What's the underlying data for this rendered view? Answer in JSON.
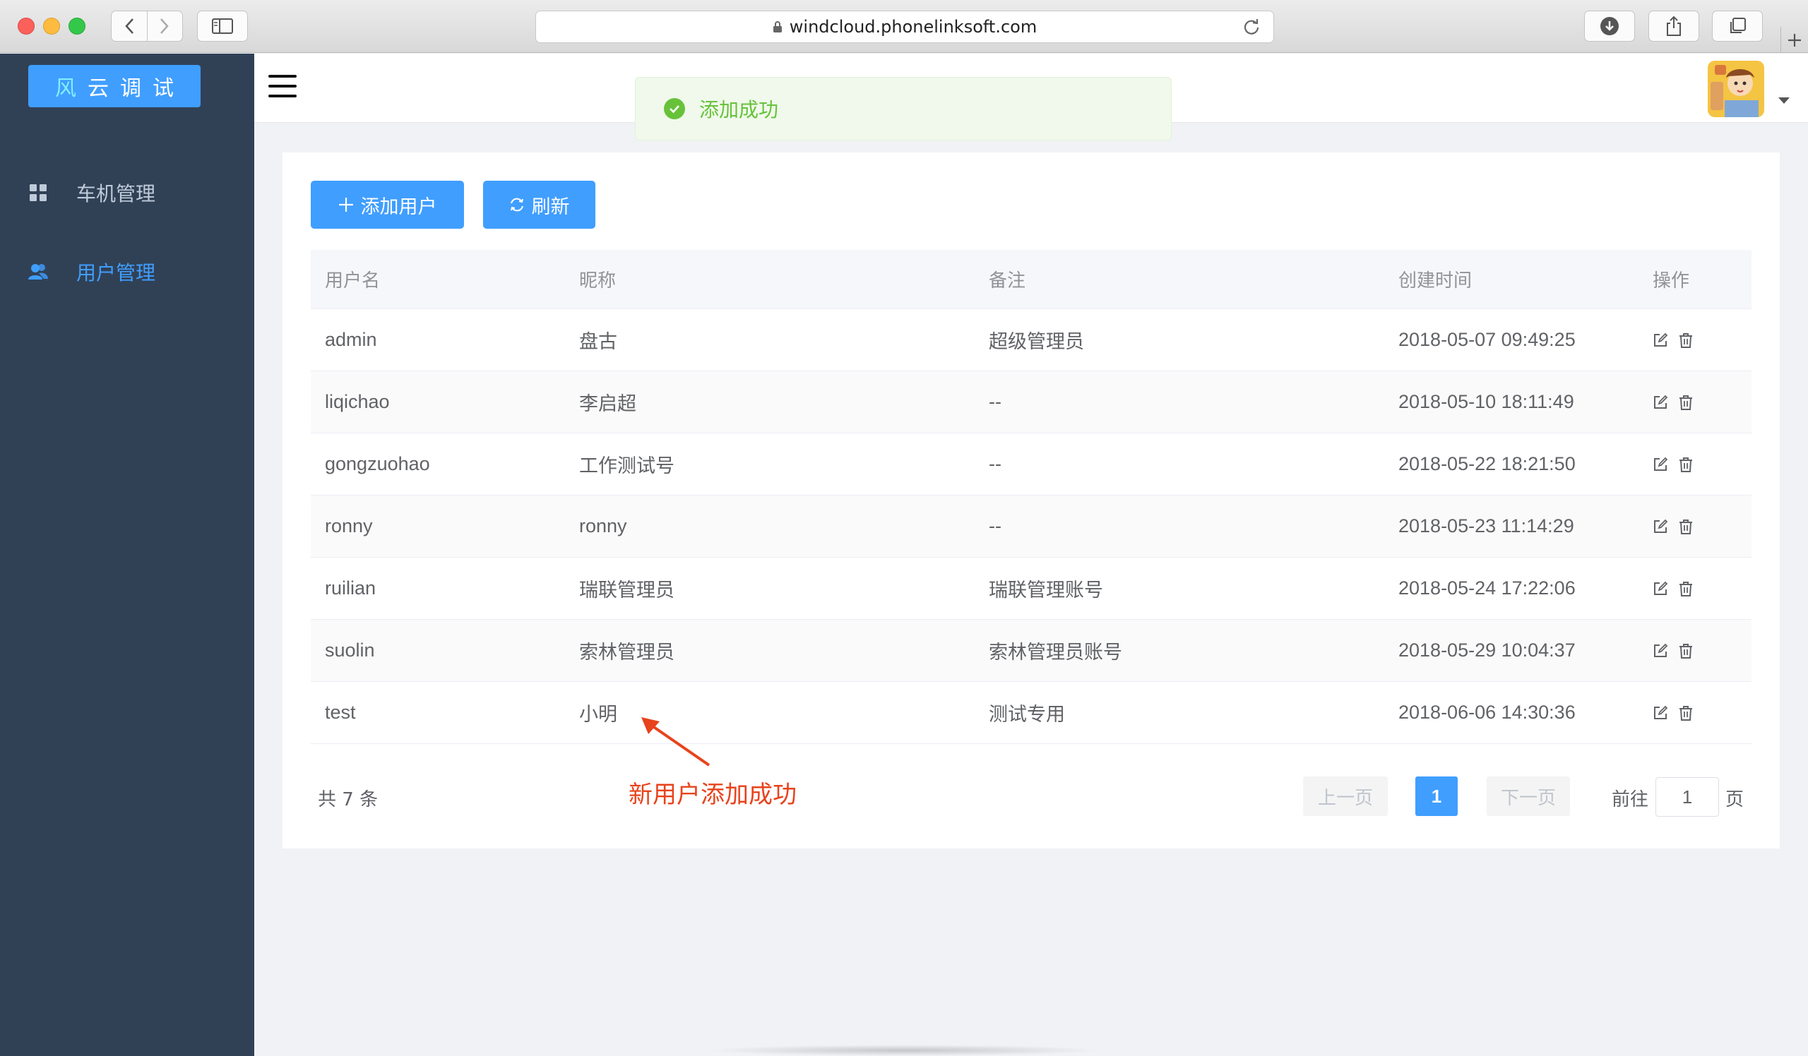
{
  "browser": {
    "url": "windcloud.phonelinksoft.com"
  },
  "sidebar": {
    "brand": [
      "风",
      "云",
      "调",
      "试"
    ],
    "items": [
      {
        "label": "车机管理",
        "icon": "grid-icon",
        "active": false
      },
      {
        "label": "用户管理",
        "icon": "users-icon",
        "active": true
      }
    ]
  },
  "toast": {
    "message": "添加成功",
    "color": "#67c23a"
  },
  "toolbar": {
    "add_label": "添加用户",
    "refresh_label": "刷新"
  },
  "table": {
    "headers": [
      "用户名",
      "昵称",
      "备注",
      "创建时间",
      "操作"
    ],
    "rows": [
      {
        "username": "admin",
        "nickname": "盘古",
        "note": "超级管理员",
        "created": "2018-05-07 09:49:25"
      },
      {
        "username": "liqichao",
        "nickname": "李启超",
        "note": "--",
        "created": "2018-05-10 18:11:49"
      },
      {
        "username": "gongzuohao",
        "nickname": "工作测试号",
        "note": "--",
        "created": "2018-05-22 18:21:50"
      },
      {
        "username": "ronny",
        "nickname": "ronny",
        "note": "--",
        "created": "2018-05-23 11:14:29"
      },
      {
        "username": "ruilian",
        "nickname": "瑞联管理员",
        "note": "瑞联管理账号",
        "created": "2018-05-24 17:22:06"
      },
      {
        "username": "suolin",
        "nickname": "索林管理员",
        "note": "索林管理员账号",
        "created": "2018-05-29 10:04:37"
      },
      {
        "username": "test",
        "nickname": "小明",
        "note": "测试专用",
        "created": "2018-06-06 14:30:36"
      }
    ]
  },
  "annotation": "新用户添加成功",
  "pagination": {
    "total": "共 7 条",
    "prev": "上一页",
    "current": "1",
    "next": "下一页",
    "goto_label": "前往",
    "goto_value": "1",
    "goto_unit": "页"
  },
  "colors": {
    "accent": "#409eff",
    "sidebar": "#304156",
    "annotation": "#e8431c"
  }
}
